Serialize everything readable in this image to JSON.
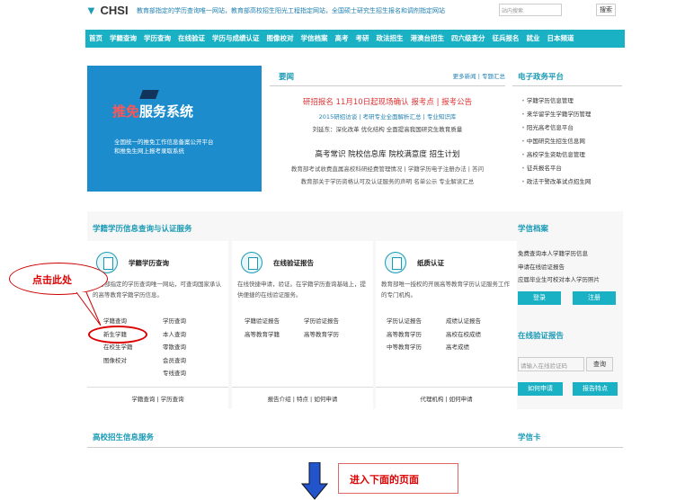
{
  "header": {
    "logo": "CHSI",
    "tagline": "教育部指定的学历查询唯一网站，教育部高校招生阳光工程指定网站，全国硕士研究生招生报名和调剂指定网站",
    "search_placeholder": "站内搜索",
    "search_button": "搜索"
  },
  "nav": [
    "首页",
    "学籍查询",
    "学历查询",
    "在线验证",
    "学历与成绩认证",
    "图像校对",
    "学信档案",
    "高考",
    "考研",
    "政法招生",
    "港澳台招生",
    "四六级查分",
    "征兵报名",
    "就业",
    "日本频道"
  ],
  "banner": {
    "title_a": "推",
    "title_b": "免",
    "title_c": "服务系统",
    "line1": "全国统一的推免工作信息备案公开平台",
    "line2": "和推免生网上报考录取系统"
  },
  "news": {
    "title": "要闻",
    "more": "更多新闻",
    "topics": "专题汇总",
    "line1": "研招报名 11月10日起现场确认  报考点 | 报考公告",
    "line2": "2015研招访谈 | 考研专业全面解析汇总 | 专业知识库",
    "line3": "刘延东：深化改革 优化结构 全面提高我国研究生教育质量",
    "line4": "高考常识  院校信息库  院校满意度  招生计划",
    "line5": "教育部考试收费直属高校科研经费管理情况 | 学籍学历电子注册办法 | 答问",
    "line6": "教育部关于学历资格认可及认证服务的声明  名单公示 专业解读汇总"
  },
  "platform": {
    "title": "电子政务平台",
    "items": [
      "学籍学历信息管理",
      "来华留学生学籍学历管理",
      "阳光高考信息平台",
      "中国研究生招生信息网",
      "高校学生资助信息管理",
      "征兵报名平台",
      "政法干警改革试点招生网"
    ]
  },
  "services": {
    "title": "学籍学历信息查询与认证服务",
    "p1": {
      "title": "学籍学历查询",
      "desc": "教育部指定的学历查询唯一网站，可查询国家承认的高等教育学籍学历信息。",
      "col1": [
        "学籍查询",
        "新生学籍",
        "在校生学籍",
        "图像校对"
      ],
      "col2": [
        "学历查询",
        "本人查询",
        "零散查询",
        "会员查询",
        "专线查询"
      ],
      "foot": "学籍查询   |   学历查询"
    },
    "p2": {
      "title": "在线验证报告",
      "desc": "在线快捷申请，验证。在学籍学历查询基础上，提供便捷的在线验证服务。",
      "col1": [
        "学籍验证报告",
        "高等教育学籍"
      ],
      "col2": [
        "学历验证报告",
        "高等教育学历"
      ],
      "foot": "报告介绍  |  特点  |  如何申请"
    },
    "p3": {
      "title": "纸质认证",
      "desc": "教育部唯一授权的开展高等教育学历认证服务工作的专门机构。",
      "col1": [
        "学历认证报告",
        "高等教育学历",
        "中等教育学历"
      ],
      "col2": [
        "成绩认证报告",
        "高校在校成绩",
        "高考成绩"
      ],
      "foot": "代理机构   |   如何申请"
    }
  },
  "archive": {
    "title": "学信档案",
    "items": [
      "免费查询本人学籍学历信息",
      "申请在线验证报告",
      "应届毕业生可校对本人学历照片"
    ],
    "login": "登录",
    "register": "注册"
  },
  "verify": {
    "title": "在线验证报告",
    "placeholder": "请输入在线验证码",
    "query": "查询",
    "how": "如何申请",
    "features": "报告特点"
  },
  "bottom": {
    "left": "高校招生信息服务",
    "right": "学信卡"
  },
  "annot": {
    "bubble": "点击此处",
    "note": "进入下面的页面"
  }
}
